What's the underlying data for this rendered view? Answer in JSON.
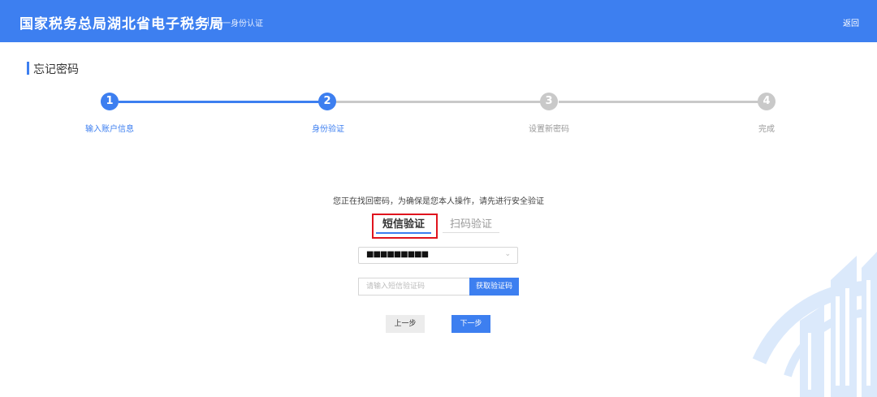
{
  "header": {
    "brand": "国家税务总局湖北省电子税务局",
    "subtitle": "统一身份认证",
    "back_label": "返回"
  },
  "page": {
    "title": "忘记密码"
  },
  "steps": [
    {
      "number": "1",
      "label": "输入账户信息",
      "status": "done"
    },
    {
      "number": "2",
      "label": "身份验证",
      "status": "current"
    },
    {
      "number": "3",
      "label": "设置新密码",
      "status": "todo"
    },
    {
      "number": "4",
      "label": "完成",
      "status": "todo"
    }
  ],
  "verify": {
    "notice": "您正在找回密码，为确保是您本人操作，请先进行安全验证",
    "tabs": [
      {
        "label": "短信验证",
        "active": true
      },
      {
        "label": "扫码验证",
        "active": false
      }
    ],
    "phone_select": {
      "value": "■■■■■■■■■"
    },
    "code_input": {
      "placeholder": "请输入短信验证码",
      "value": ""
    },
    "get_code_label": "获取验证码",
    "prev_label": "上一步",
    "next_label": "下一步"
  },
  "colors": {
    "primary": "#3d7ff0",
    "inactive_step": "#c9c9c9",
    "highlight": "#e0141e",
    "watermark": "#dbe9fb"
  },
  "icons": {
    "select_arrow": "chevron-down-icon",
    "watermark": "tax-emblem-watermark"
  }
}
